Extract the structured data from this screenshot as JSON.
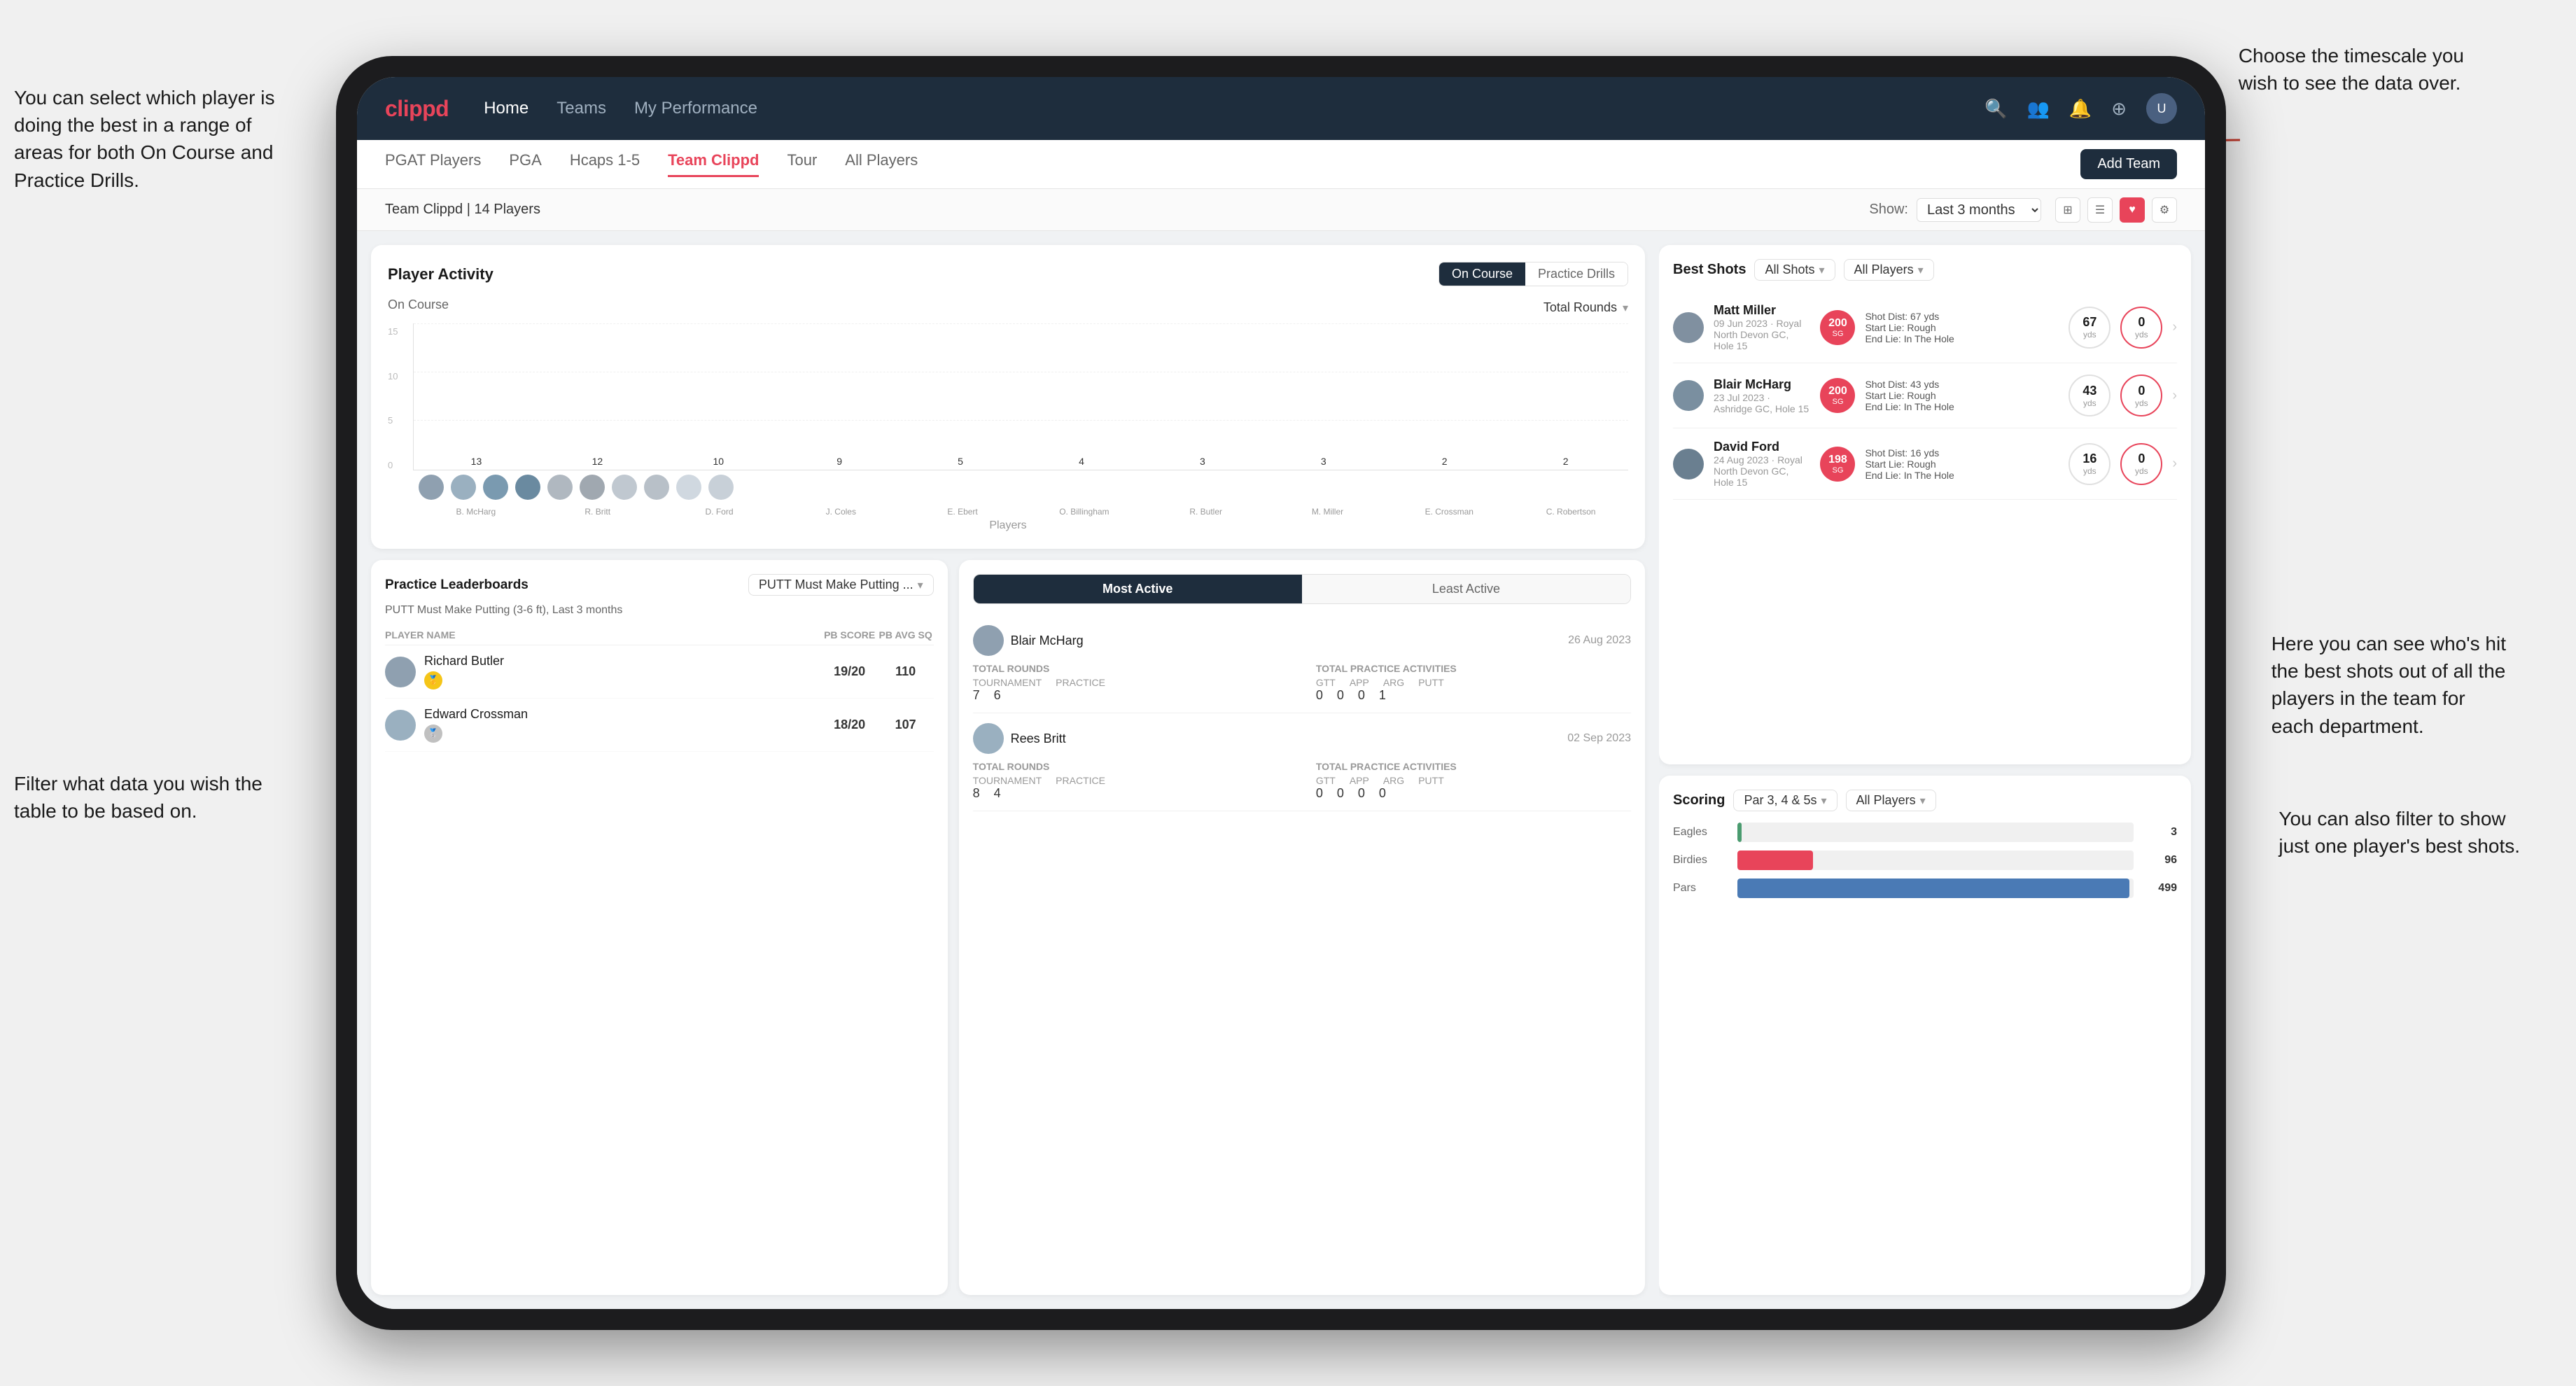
{
  "annotations": {
    "top_right": "Choose the timescale you\nwish to see the data over.",
    "top_left": "You can select which player is\ndoing the best in a range of\nareas for both On Course and\nPractice Drills.",
    "bottom_left": "Filter what data you wish the\ntable to be based on.",
    "right_mid": "Here you can see who's hit\nthe best shots out of all the\nplayers in the team for\neach department.",
    "right_bottom": "You can also filter to show\njust one player's best shots."
  },
  "nav": {
    "logo": "clippd",
    "items": [
      "Home",
      "Teams",
      "My Performance"
    ],
    "active": "Home"
  },
  "tabs": {
    "items": [
      "PGAT Players",
      "PGA",
      "Hcaps 1-5",
      "Team Clippd",
      "Tour",
      "All Players"
    ],
    "active": "Team Clippd",
    "add_btn": "Add Team"
  },
  "toolbar": {
    "team_label": "Team Clippd | 14 Players",
    "show_label": "Show:",
    "months_label": "Last 3 months"
  },
  "activity_card": {
    "title": "Player Activity",
    "toggle_on_course": "On Course",
    "toggle_practice": "Practice Drills",
    "section_label": "On Course",
    "filter_label": "Total Rounds",
    "y_axis_label": "Total Rounds",
    "y_ticks": [
      "15",
      "10",
      "5",
      "0"
    ],
    "bars": [
      {
        "player": "B. McHarg",
        "value": 13,
        "height": 86
      },
      {
        "player": "R. Britt",
        "value": 12,
        "height": 80
      },
      {
        "player": "D. Ford",
        "value": 10,
        "height": 67
      },
      {
        "player": "J. Coles",
        "value": 9,
        "height": 60
      },
      {
        "player": "E. Ebert",
        "value": 5,
        "height": 33
      },
      {
        "player": "O. Billingham",
        "value": 4,
        "height": 27
      },
      {
        "player": "R. Butler",
        "value": 3,
        "height": 20
      },
      {
        "player": "M. Miller",
        "value": 3,
        "height": 20
      },
      {
        "player": "E. Crossman",
        "value": 2,
        "height": 13
      },
      {
        "player": "C. Robertson",
        "value": 2,
        "height": 13
      }
    ],
    "x_axis_label": "Players"
  },
  "leaderboard": {
    "title": "Practice Leaderboards",
    "drill_label": "PUTT Must Make Putting ...",
    "subtitle": "PUTT Must Make Putting (3-6 ft), Last 3 months",
    "cols": [
      "PLAYER NAME",
      "PB SCORE",
      "PB AVG SQ"
    ],
    "rows": [
      {
        "name": "Richard Butler",
        "rank": 1,
        "rank_type": "gold",
        "pb_score": "19/20",
        "pb_avg": "110"
      },
      {
        "name": "Edward Crossman",
        "rank": 2,
        "rank_type": "silver",
        "pb_score": "18/20",
        "pb_avg": "107"
      }
    ]
  },
  "most_active": {
    "tab_active": "Most Active",
    "tab_least": "Least Active",
    "players": [
      {
        "name": "Blair McHarg",
        "date": "26 Aug 2023",
        "total_rounds_label": "Total Rounds",
        "tournament": "7",
        "practice": "6",
        "total_practice_label": "Total Practice Activities",
        "gtt": "0",
        "app": "0",
        "arg": "0",
        "putt": "1"
      },
      {
        "name": "Rees Britt",
        "date": "02 Sep 2023",
        "total_rounds_label": "Total Rounds",
        "tournament": "8",
        "practice": "4",
        "total_practice_label": "Total Practice Activities",
        "gtt": "0",
        "app": "0",
        "arg": "0",
        "putt": "0"
      }
    ]
  },
  "best_shots": {
    "title": "Best Shots",
    "filter_all_shots": "All Shots",
    "filter_all_players": "All Players",
    "shots": [
      {
        "player": "Matt Miller",
        "meta": "09 Jun 2023 · Royal North Devon GC, Hole 15",
        "badge_val": "200",
        "badge_sg": "SG",
        "detail_line1": "Shot Dist: 67 yds",
        "detail_line2": "Start Lie: Rough",
        "detail_line3": "End Lie: In The Hole",
        "stat1_val": "67",
        "stat1_unit": "yds",
        "stat2_val": "0",
        "stat2_unit": "yds"
      },
      {
        "player": "Blair McHarg",
        "meta": "23 Jul 2023 · Ashridge GC, Hole 15",
        "badge_val": "200",
        "badge_sg": "SG",
        "detail_line1": "Shot Dist: 43 yds",
        "detail_line2": "Start Lie: Rough",
        "detail_line3": "End Lie: In The Hole",
        "stat1_val": "43",
        "stat1_unit": "yds",
        "stat2_val": "0",
        "stat2_unit": "yds"
      },
      {
        "player": "David Ford",
        "meta": "24 Aug 2023 · Royal North Devon GC, Hole 15",
        "badge_val": "198",
        "badge_sg": "SG",
        "detail_line1": "Shot Dist: 16 yds",
        "detail_line2": "Start Lie: Rough",
        "detail_line3": "End Lie: In The Hole",
        "stat1_val": "16",
        "stat1_unit": "yds",
        "stat2_val": "0",
        "stat2_unit": "yds"
      }
    ]
  },
  "scoring": {
    "title": "Scoring",
    "filter_par": "Par 3, 4 & 5s",
    "filter_players": "All Players",
    "rows": [
      {
        "label": "Eagles",
        "value": 3,
        "max": 500,
        "type": "eagles",
        "display": "3"
      },
      {
        "label": "Birdies",
        "value": 96,
        "max": 500,
        "type": "birdies",
        "display": "96"
      },
      {
        "label": "Pars",
        "value": 499,
        "max": 500,
        "type": "pars",
        "display": "499"
      }
    ]
  },
  "colors": {
    "primary": "#e8445a",
    "dark_nav": "#1e2d3d",
    "accent_blue": "#4a7ab5"
  }
}
